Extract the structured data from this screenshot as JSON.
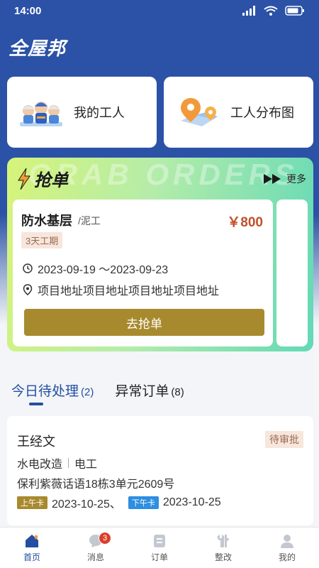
{
  "status_bar": {
    "time": "14:00"
  },
  "app": {
    "title": "全屋邦"
  },
  "quick_actions": [
    {
      "label": "我的工人",
      "icon": "workers-icon"
    },
    {
      "label": "工人分布图",
      "icon": "map-pin-icon"
    }
  ],
  "grab_section": {
    "title": "抢单",
    "watermark": "GRAB ORDERS",
    "more_label": "更多",
    "order": {
      "name": "防水基层",
      "trade": "/泥工",
      "price": "￥800",
      "duration_badge": "3天工期",
      "date_range": "2023-09-19 ～2023-09-23",
      "address": "项目地址项目地址项目地址项目地址",
      "button_label": "去抢单"
    }
  },
  "tabs": [
    {
      "label": "今日待处理",
      "count": "(2)",
      "active": true
    },
    {
      "label": "异常订单",
      "count": "(8)",
      "active": false
    }
  ],
  "task": {
    "worker_name": "王经文",
    "status": "待审批",
    "job": "水电改造",
    "trade": "电工",
    "address": "保利紫薇话语18栋3单元2609号",
    "am_tag": "上午卡",
    "am_date": "2023-10-25、",
    "pm_tag": "下午卡",
    "pm_date": "2023-10-25"
  },
  "bottom_nav": [
    {
      "label": "首页",
      "icon": "home-icon",
      "active": true
    },
    {
      "label": "消息",
      "icon": "message-icon",
      "badge": "3"
    },
    {
      "label": "订单",
      "icon": "order-icon"
    },
    {
      "label": "整改",
      "icon": "wrench-icon"
    },
    {
      "label": "我的",
      "icon": "profile-icon"
    }
  ],
  "colors": {
    "primary_blue": "#2b52a6",
    "gold_button": "#a88a2e",
    "price_red": "#c0502a",
    "badge_red": "#d9402c"
  }
}
